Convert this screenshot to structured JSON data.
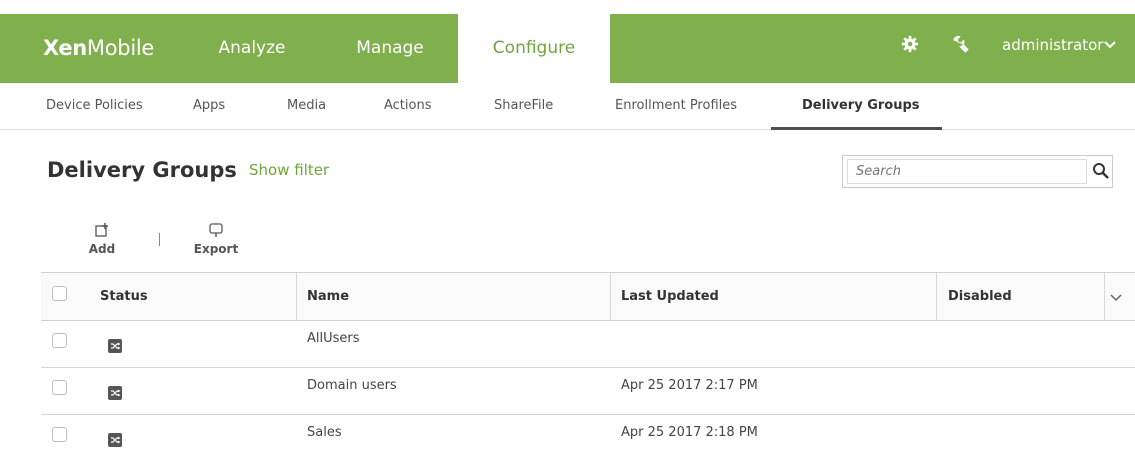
{
  "app": {
    "brand_bold": "Xen",
    "brand_light": "Mobile"
  },
  "topnav": {
    "tabs": [
      {
        "label": "Analyze",
        "active": false
      },
      {
        "label": "Manage",
        "active": false
      },
      {
        "label": "Configure",
        "active": true
      }
    ],
    "icons": [
      "gear-icon",
      "wrench-icon"
    ],
    "user": "administrator"
  },
  "subnav": {
    "items": [
      {
        "label": "Device Policies",
        "active": false
      },
      {
        "label": "Apps",
        "active": false
      },
      {
        "label": "Media",
        "active": false
      },
      {
        "label": "Actions",
        "active": false
      },
      {
        "label": "ShareFile",
        "active": false
      },
      {
        "label": "Enrollment Profiles",
        "active": false
      },
      {
        "label": "Delivery Groups",
        "active": true
      }
    ]
  },
  "page": {
    "title": "Delivery Groups",
    "show_filter": "Show filter",
    "search_placeholder": "Search"
  },
  "actions": {
    "add": "Add",
    "export": "Export"
  },
  "table": {
    "columns": [
      "Status",
      "Name",
      "Last Updated",
      "Disabled"
    ],
    "rows": [
      {
        "name": "AllUsers",
        "last_updated": "",
        "disabled": ""
      },
      {
        "name": "Domain users",
        "last_updated": "Apr 25 2017 2:17 PM",
        "disabled": ""
      },
      {
        "name": "Sales",
        "last_updated": "Apr 25 2017 2:18 PM",
        "disabled": ""
      }
    ]
  },
  "colors": {
    "brand_green": "#7fb04d",
    "accent_green": "#6fa53c"
  }
}
